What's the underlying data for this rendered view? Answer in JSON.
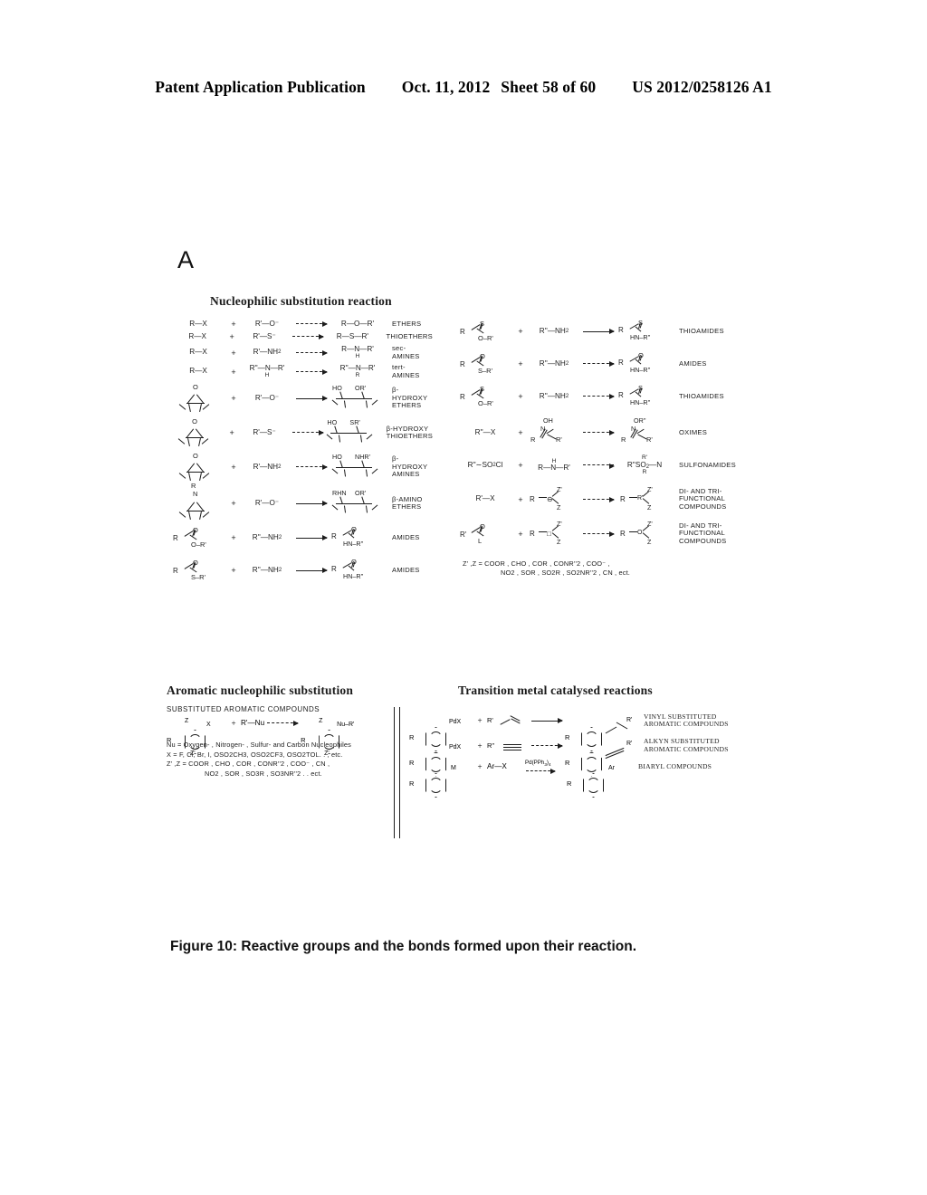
{
  "header": {
    "publication": "Patent Application Publication",
    "date": "Oct. 11, 2012",
    "sheet": "Sheet 58 of 60",
    "docnum": "US 2012/0258126 A1"
  },
  "panel_label": "A",
  "figure": {
    "nucleophilic_title": "Nucleophilic substitution reaction",
    "left_reactions": [
      {
        "reactant": "R—X",
        "reagent": "R'—O⁻",
        "product": "R—O—R'",
        "label": "ETHERS"
      },
      {
        "reactant": "R—X",
        "reagent": "R'—S⁻",
        "product": "R—S—R'",
        "label": "THIOETHERS"
      },
      {
        "reactant": "R—X",
        "reagent": "R'—NH2",
        "product": "R—N—R'",
        "product_sub": "H",
        "label": "sec- AMINES"
      },
      {
        "reactant": "R—X",
        "reagent": "R''—N—R'",
        "reagent_sub": "H",
        "product": "R''—N—R'",
        "product_sub": "R",
        "label": "tert-AMINES"
      },
      {
        "reactant": "epoxide",
        "reagent": "R'—O⁻",
        "product": "HO  OR'",
        "label": "β-HYDROXY ETHERS"
      },
      {
        "reactant": "epoxide",
        "reagent": "R'—S⁻",
        "product": "HO  SR'",
        "label": "β-HYDROXY THIOETHERS"
      },
      {
        "reactant": "epoxide",
        "reagent": "R'—NH2",
        "product": "HO  NHR'",
        "label": "β-HYDROXY AMINES"
      },
      {
        "reactant": "aziridine",
        "reagent": "R'—O⁻",
        "product": "RHN  OR'",
        "label": "β-AMINO ETHERS"
      },
      {
        "reactant": "ester",
        "reagent": "R''—NH2",
        "product": "amide",
        "label": "AMIDES"
      },
      {
        "reactant": "thioester",
        "reagent": "R''—NH2",
        "product": "amide",
        "label": "AMIDES"
      }
    ],
    "right_reactions": [
      {
        "reactant": "thionoester",
        "reagent": "R''—NH2",
        "product": "thioamide",
        "label": "THIOAMIDES"
      },
      {
        "reactant": "thioester",
        "reagent": "R''—NH2",
        "product": "amide",
        "label": "AMIDES"
      },
      {
        "reactant": "thionoester",
        "reagent": "R''—NH2",
        "product": "thioamide",
        "label": "THIOAMIDES"
      },
      {
        "reactant": "R''—X",
        "reagent": "oxime-OH",
        "product": "oxime-OR''",
        "label": "OXIMES"
      },
      {
        "reactant": "R''—SO2Cl",
        "reagent": "R—N(H)—R'",
        "product": "R''SO2—N(R')R",
        "label": "SULFONAMIDES"
      },
      {
        "reactant": "R'—X",
        "reagent": "Z-carbanion",
        "product": "R—C(Z')(Z)—R'",
        "label": "DI- AND TRI-FUNCTIONAL COMPOUNDS"
      },
      {
        "reactant": "acyl-L",
        "reagent": "Z-carbanion",
        "product": "R—C(Z')(Z)—CO—R'",
        "label": "DI- AND TRI-FUNCTIONAL COMPOUNDS"
      }
    ],
    "z_legend_line1": "Z' ,Z  =   COOR ,   CHO ,   COR ,   CONR''2 ,   COO⁻ ,",
    "z_legend_line2": "NO2 ,      SOR ,    SO2R ,   SO2NR''2 ,    CN , ect.",
    "aromatic_title": "Aromatic nucleophilic substitution",
    "aromatic_subtitle": "SUBSTITUTED AROMATIC COMPOUNDS",
    "aromatic_reagent": "R'—Nu",
    "aromatic_notes": [
      "Nu = Oxygen- , Nitrogen- , Sulfur- and Carbon Nucleophiles",
      "X = F, Cl, Br, I, OSO2CH3, OSO2CF3, OSO2TOL. . , etc.",
      "Z' ,Z  =  COOR , CHO , COR , CONR''2 , COO⁻ , CN ,",
      "NO2 , SOR , SO3R , SO3NR''2 . . ect."
    ],
    "transition_title": "Transition metal catalysed reactions",
    "transition_reactions": [
      {
        "substituent": "PdX",
        "reagent": "R'—CH=CH2",
        "catalyst": "",
        "product": "vinyl-arene",
        "label": "VINYL SUBSTITUTED AROMATIC COMPOUNDS"
      },
      {
        "substituent": "PdX",
        "reagent": "R'—C≡CH",
        "catalyst": "",
        "product": "alkynyl-arene",
        "label": "ALKYN SUBSTITUTED AROMATIC COMPOUNDS"
      },
      {
        "substituent": "M",
        "reagent": "Ar—X",
        "catalyst": "Pd(PPh3)4",
        "product": "Ar",
        "label": "BIARYL COMPOUNDS"
      }
    ]
  },
  "caption": "Figure 10:  Reactive groups and the bonds formed upon their reaction."
}
